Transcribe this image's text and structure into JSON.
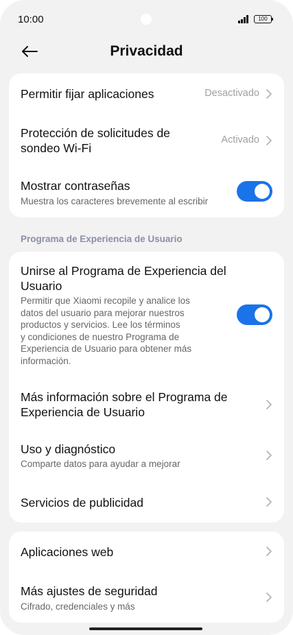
{
  "status_bar": {
    "time": "10:00",
    "battery": "100"
  },
  "header": {
    "title": "Privacidad"
  },
  "card1": {
    "items": [
      {
        "title": "Permitir fijar aplicaciones",
        "value": "Desactivado"
      },
      {
        "title_line1": "Protección de solicitudes de",
        "title_line2": "sondeo Wi-Fi",
        "value": "Activado"
      },
      {
        "title": "Mostrar contraseñas",
        "subtitle": "Muestra los caracteres brevemente al escribir",
        "toggle": true
      }
    ]
  },
  "section": {
    "label": "Programa de Experiencia de Usuario"
  },
  "card2": {
    "join": {
      "title_line1": "Unirse al Programa de Experiencia del",
      "title_line2": "Usuario",
      "desc_lines": [
        "Permitir que Xiaomi recopile y analice los",
        "datos del usuario para mejorar nuestros",
        "productos y servicios. Lee los términos",
        "y condiciones de nuestro Programa de",
        "Experiencia de Usuario para obtener más",
        "información."
      ],
      "toggle": true
    },
    "more_info": {
      "title_line1": "Más información sobre el Programa de",
      "title_line2": "Experiencia de Usuario"
    },
    "usage": {
      "title": "Uso y diagnóstico",
      "subtitle": "Comparte datos para ayudar a mejorar"
    },
    "ads": {
      "title": "Servicios de publicidad"
    }
  },
  "card3": {
    "web_apps": {
      "title": "Aplicaciones web"
    },
    "security": {
      "title": "Más ajustes de seguridad",
      "subtitle": "Cifrado, credenciales y más"
    }
  },
  "colors": {
    "accent": "#1a73e8",
    "background": "#f2f2f2",
    "card": "#ffffff"
  },
  "icons": [
    "back-arrow-icon",
    "chevron-right-icon",
    "signal-icon",
    "battery-icon"
  ]
}
